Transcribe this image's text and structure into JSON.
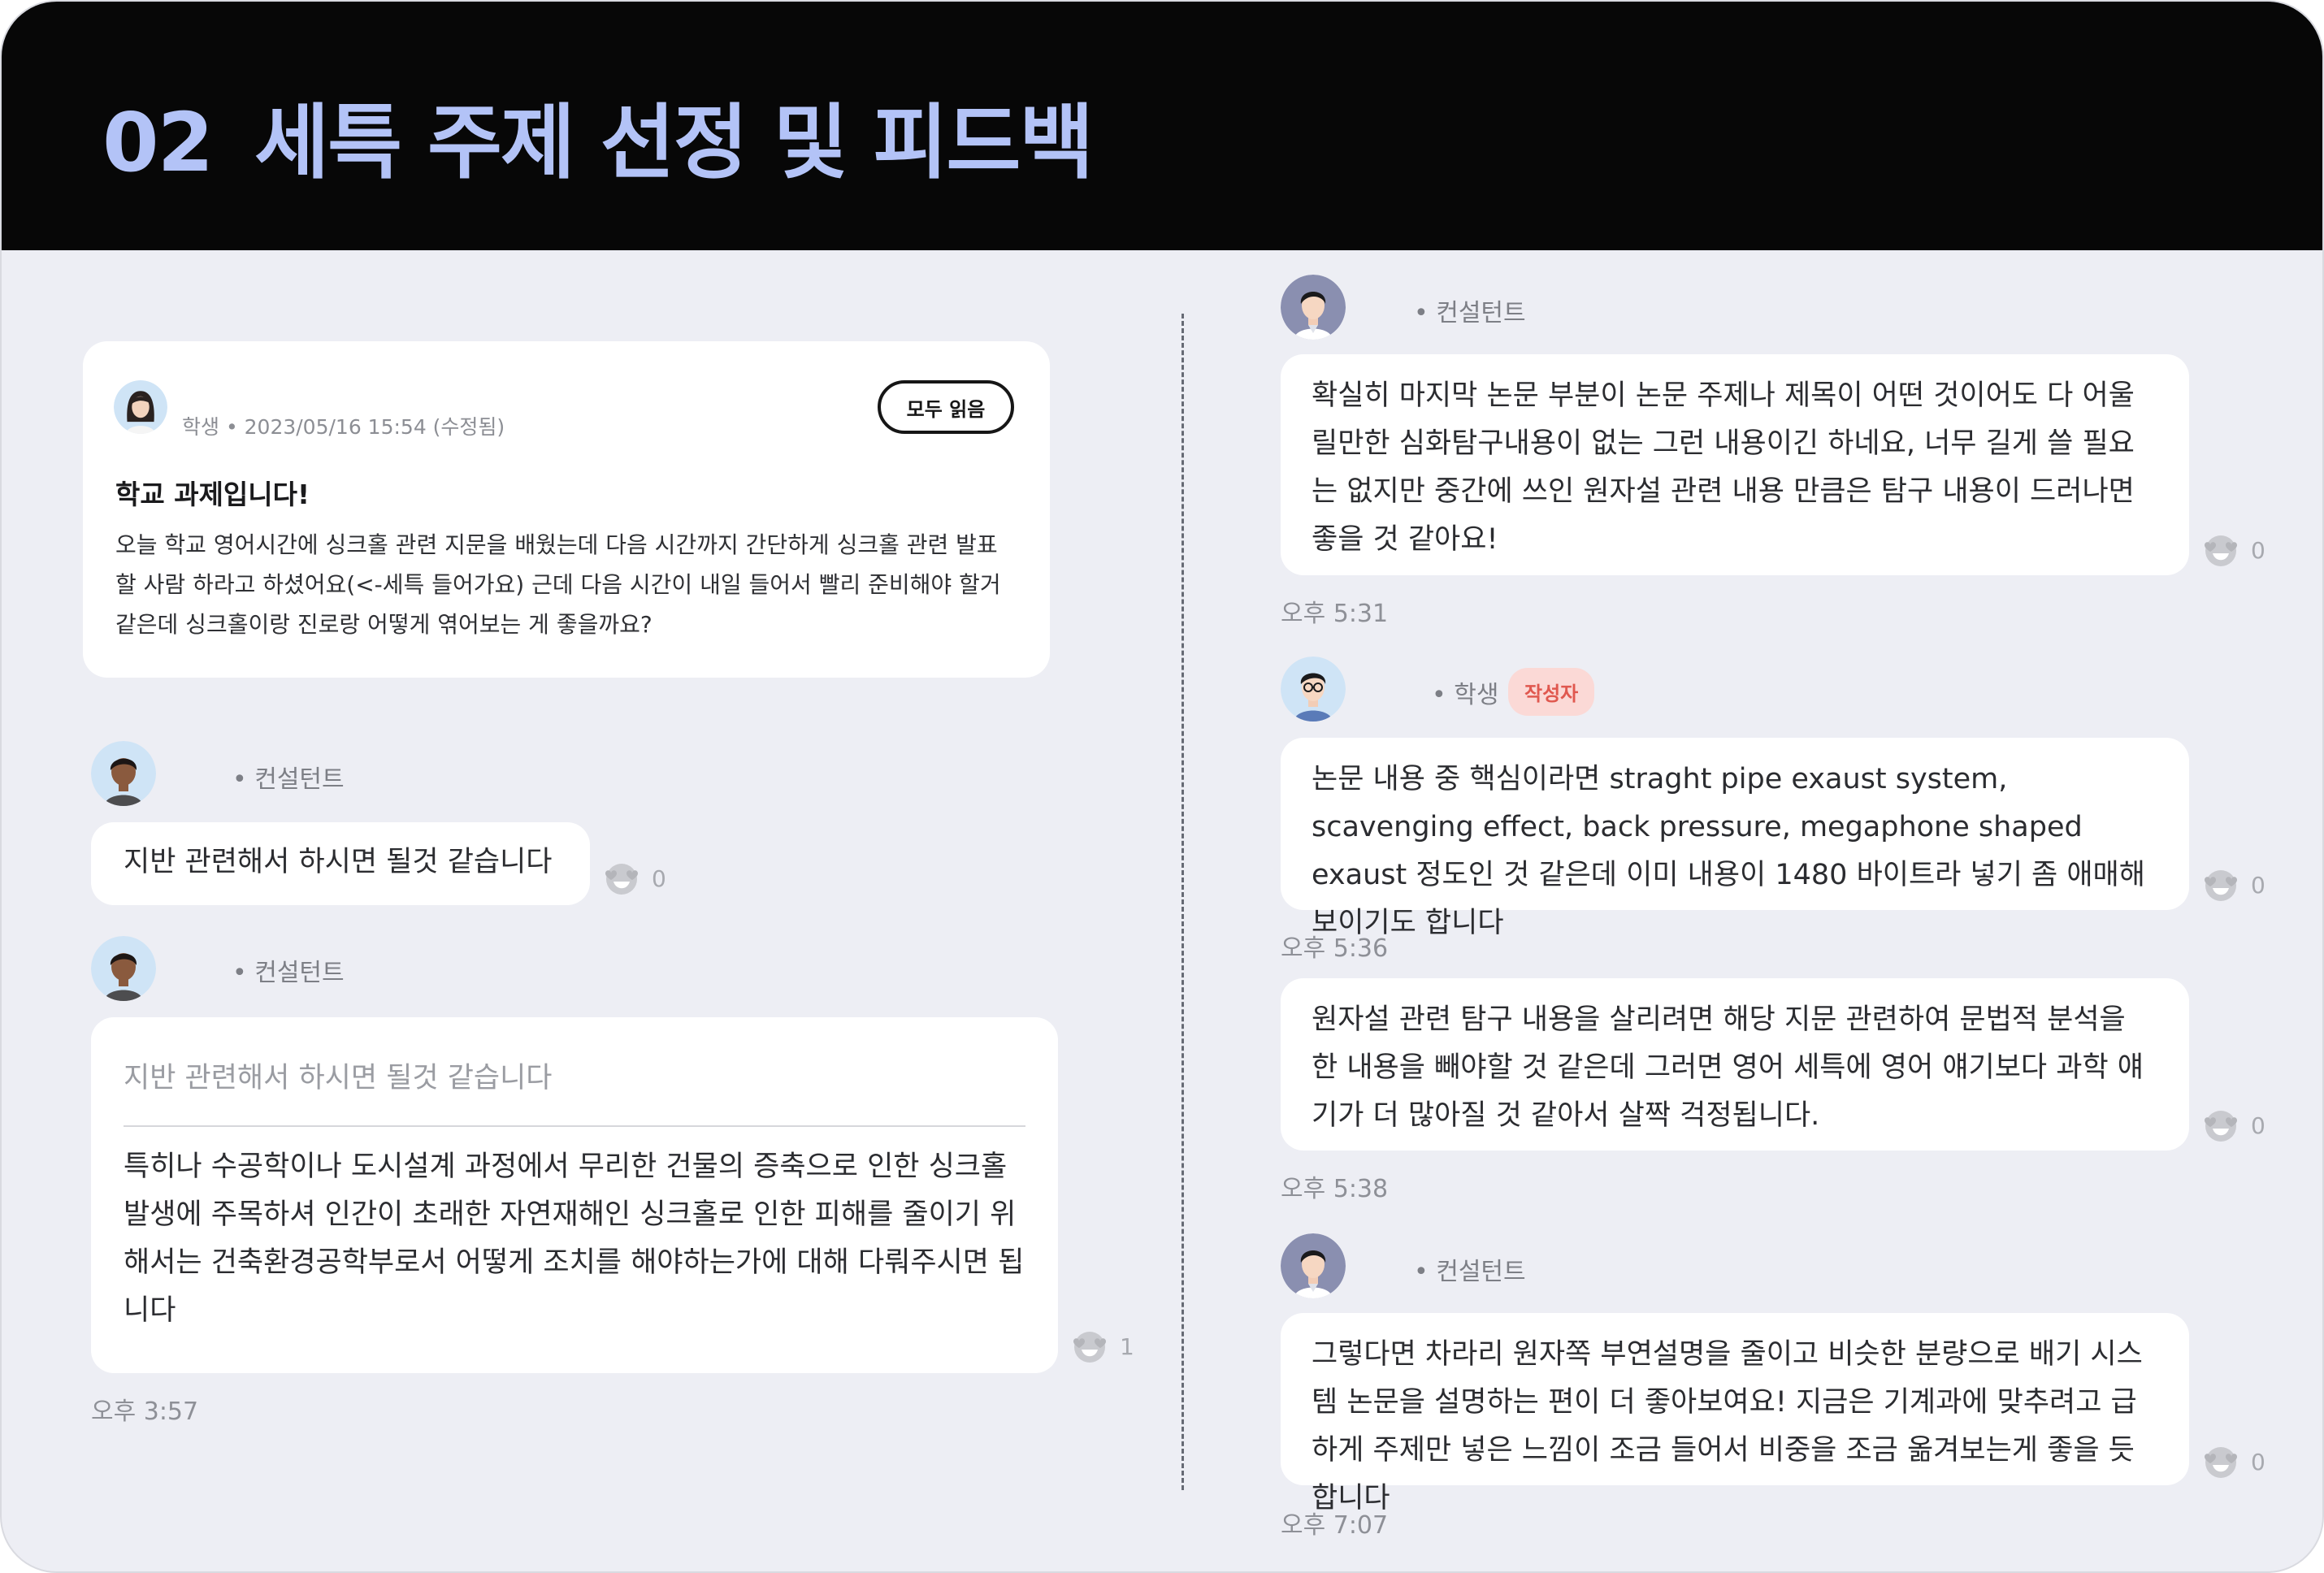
{
  "header": {
    "number": "02",
    "title": "세특 주제 선정 및 피드백"
  },
  "post": {
    "meta": "학생 • 2023/05/16 15:54 (수정됨)",
    "read_all_label": "모두 읽음",
    "title": "학교 과제입니다!",
    "body": "오늘 학교 영어시간에 싱크홀 관련 지문을 배웠는데 다음 시간까지 간단하게 싱크홀 관련 발표할 사람 하라고 하셨어요(<-세특 들어가요) 근데  다음 시간이 내일 들어서  빨리 준비해야 할거 같은데 싱크홀이랑 진로랑 어떻게 엮어보는 게 좋을까요?"
  },
  "left_comments": [
    {
      "role": "• 컨설턴트",
      "text": "지반 관련해서 하시면 될것 같습니다",
      "likes": "0"
    },
    {
      "role": "• 컨설턴트",
      "quote": "지반 관련해서 하시면 될것 같습니다",
      "text": "특히나 수공학이나 도시설계 과정에서 무리한 건물의 증축으로 인한 싱크홀 발생에 주목하셔 인간이 초래한 자연재해인 싱크홀로 인한 피해를 줄이기 위해서는 건축환경공학부로서 어떻게 조치를 해야하는가에 대해 다뤄주시면 됩니다",
      "likes": "1",
      "time": "오후 3:57"
    }
  ],
  "right_comments": [
    {
      "role": "• 컨설턴트",
      "text": "확실히 마지막 논문 부분이 논문 주제나 제목이 어떤 것이어도 다 어울릴만한 심화탐구내용이 없는 그런 내용이긴 하네요, 너무 길게 쓸 필요는 없지만 중간에 쓰인 원자설 관련 내용 만큼은 탐구 내용이 드러나면 좋을 것 같아요!",
      "likes": "0",
      "time": "오후 5:31"
    },
    {
      "role": "• 학생",
      "badge": "작성자",
      "text": "논문 내용 중 핵심이라면 straght pipe exaust system, scavenging effect, back pressure, megaphone shaped exaust 정도인 것 같은데 이미 내용이 1480 바이트라 넣기 좀 애매해 보이기도 합니다",
      "likes": "0",
      "time": "오후 5:36"
    },
    {
      "text": "원자설 관련 탐구 내용을 살리려면 해당 지문 관련하여 문법적 분석을 한 내용을 빼야할 것 같은데 그러면 영어 세특에 영어 얘기보다 과학 얘기가 더 많아질 것 같아서 살짝 걱정됩니다.",
      "likes": "0",
      "time": "오후 5:38"
    },
    {
      "role": "• 컨설턴트",
      "text": "그렇다면 차라리 원자쪽 부연설명을 줄이고 비슷한 분량으로 배기 시스템 논문을 설명하는 편이 더 좋아보여요! 지금은 기계과에 맞추려고 급하게 주제만 넣은 느낌이 조금 들어서 비중을 조금 옮겨보는게 좋을 듯합니다",
      "likes": "0",
      "time": "오후 7:07"
    }
  ],
  "colors": {
    "header_bg": "#070707",
    "header_text": "#b3c3f7",
    "page_bg": "#edeef4",
    "badge_bg": "#fbd9d6",
    "badge_text": "#e0584f"
  }
}
